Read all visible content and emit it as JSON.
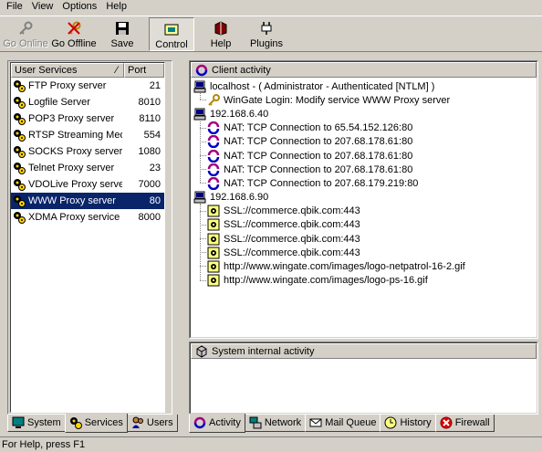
{
  "menu": [
    "File",
    "View",
    "Options",
    "Help"
  ],
  "toolbar": [
    {
      "label": "Go Online",
      "icon": "key-icon",
      "disabled": true
    },
    {
      "label": "Go Offline",
      "icon": "key-crossed-icon"
    },
    {
      "label": "Save",
      "icon": "floppy-disk-icon"
    },
    {
      "label": "Control",
      "icon": "control-panel-icon",
      "pressed": true
    },
    {
      "label": "Help",
      "icon": "help-book-icon"
    },
    {
      "label": "Plugins",
      "icon": "plug-icon"
    }
  ],
  "services": {
    "headers": {
      "name": "User Services",
      "port": "Port"
    },
    "rows": [
      {
        "name": "FTP Proxy server",
        "port": "21"
      },
      {
        "name": "Logfile Server",
        "port": "8010"
      },
      {
        "name": "POP3 Proxy server",
        "port": "8110"
      },
      {
        "name": "RTSP Streaming Medi...",
        "port": "554"
      },
      {
        "name": "SOCKS Proxy server",
        "port": "1080"
      },
      {
        "name": "Telnet Proxy server",
        "port": "23"
      },
      {
        "name": "VDOLive Proxy server",
        "port": "7000"
      },
      {
        "name": "WWW Proxy server",
        "port": "80",
        "selected": true
      },
      {
        "name": "XDMA Proxy service",
        "port": "8000"
      }
    ]
  },
  "left_tabs": [
    {
      "label": "System",
      "icon": "monitor-icon"
    },
    {
      "label": "Services",
      "icon": "gears-icon",
      "active": true
    },
    {
      "label": "Users",
      "icon": "users-icon"
    }
  ],
  "client_activity": {
    "title": "Client activity",
    "tree": [
      {
        "level": 0,
        "icon": "computer-icon",
        "text": "localhost  -  ( Administrator  -  Authenticated [NTLM] )"
      },
      {
        "level": 1,
        "icon": "key-icon",
        "text": "WinGate Login: Modify service WWW Proxy server"
      },
      {
        "level": 0,
        "icon": "computer-icon",
        "text": "192.168.6.40"
      },
      {
        "level": 1,
        "icon": "nat-icon",
        "text": "NAT: TCP Connection to 65.54.152.126:80"
      },
      {
        "level": 1,
        "icon": "nat-icon",
        "text": "NAT: TCP Connection to 207.68.178.61:80"
      },
      {
        "level": 1,
        "icon": "nat-icon",
        "text": "NAT: TCP Connection to 207.68.178.61:80"
      },
      {
        "level": 1,
        "icon": "nat-icon",
        "text": "NAT: TCP Connection to 207.68.178.61:80"
      },
      {
        "level": 1,
        "icon": "nat-icon",
        "text": "NAT: TCP Connection to 207.68.179.219:80"
      },
      {
        "level": 0,
        "icon": "computer-icon",
        "text": "192.168.6.90"
      },
      {
        "level": 1,
        "icon": "www-icon",
        "text": "SSL://commerce.qbik.com:443"
      },
      {
        "level": 1,
        "icon": "www-icon",
        "text": "SSL://commerce.qbik.com:443"
      },
      {
        "level": 1,
        "icon": "www-icon",
        "text": "SSL://commerce.qbik.com:443"
      },
      {
        "level": 1,
        "icon": "www-icon",
        "text": "SSL://commerce.qbik.com:443"
      },
      {
        "level": 1,
        "icon": "www-icon",
        "text": "http://www.wingate.com/images/logo-netpatrol-16-2.gif"
      },
      {
        "level": 1,
        "icon": "www-icon",
        "text": "http://www.wingate.com/images/logo-ps-16.gif"
      }
    ]
  },
  "system_activity": {
    "title": "System internal activity"
  },
  "right_tabs": [
    {
      "label": "Activity",
      "icon": "activity-icon",
      "active": true
    },
    {
      "label": "Network",
      "icon": "network-icon"
    },
    {
      "label": "Mail Queue",
      "icon": "mail-icon"
    },
    {
      "label": "History",
      "icon": "clock-icon"
    },
    {
      "label": "Firewall",
      "icon": "firewall-icon"
    }
  ],
  "status": "For Help, press F1"
}
